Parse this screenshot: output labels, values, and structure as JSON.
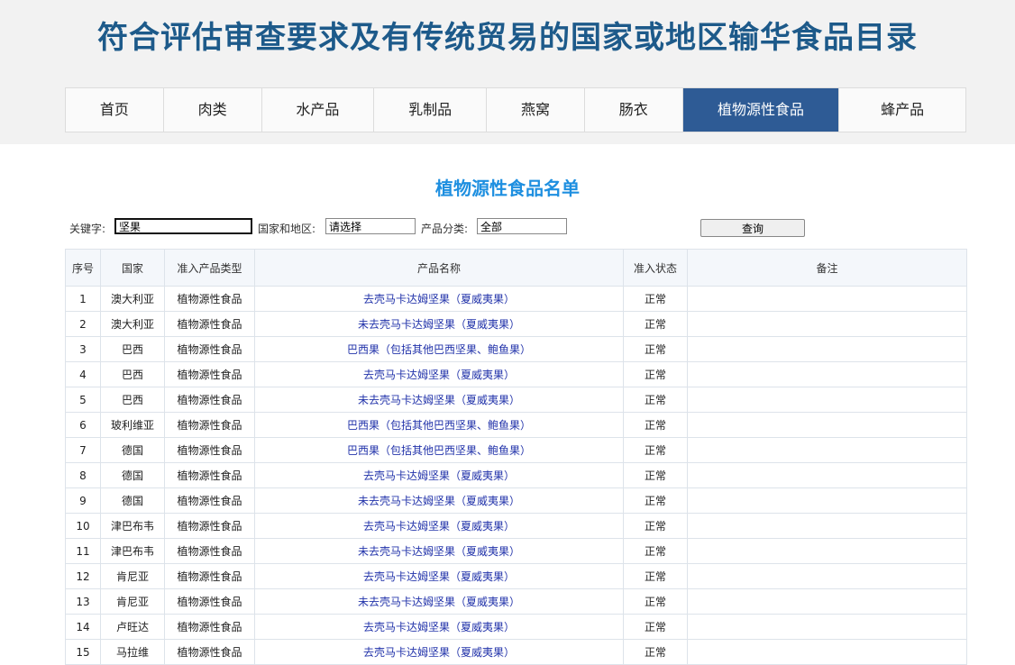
{
  "site_title": "符合评估审查要求及有传统贸易的国家或地区输华食品目录",
  "nav": [
    {
      "label": "首页"
    },
    {
      "label": "肉类"
    },
    {
      "label": "水产品"
    },
    {
      "label": "乳制品"
    },
    {
      "label": "燕窝"
    },
    {
      "label": "肠衣"
    },
    {
      "label": "植物源性食品",
      "active": true
    },
    {
      "label": "蜂产品"
    }
  ],
  "list_title": "植物源性食品名单",
  "search": {
    "keyword_label": "关键字:",
    "keyword_value": "坚果",
    "country_label": "国家和地区:",
    "country_value": "请选择",
    "category_label": "产品分类:",
    "category_value": "全部",
    "query_button": "查询"
  },
  "table": {
    "headers": {
      "seq": "序号",
      "country": "国家",
      "type": "准入产品类型",
      "product": "产品名称",
      "status": "准入状态",
      "remark": "备注"
    },
    "rows": [
      {
        "seq": "1",
        "country": "澳大利亚",
        "type": "植物源性食品",
        "product": "去壳马卡达姆坚果（夏威夷果）",
        "status": "正常",
        "remark": ""
      },
      {
        "seq": "2",
        "country": "澳大利亚",
        "type": "植物源性食品",
        "product": "未去壳马卡达姆坚果（夏威夷果）",
        "status": "正常",
        "remark": ""
      },
      {
        "seq": "3",
        "country": "巴西",
        "type": "植物源性食品",
        "product": "巴西果（包括其他巴西坚果、鲍鱼果）",
        "status": "正常",
        "remark": ""
      },
      {
        "seq": "4",
        "country": "巴西",
        "type": "植物源性食品",
        "product": "去壳马卡达姆坚果（夏威夷果）",
        "status": "正常",
        "remark": ""
      },
      {
        "seq": "5",
        "country": "巴西",
        "type": "植物源性食品",
        "product": "未去壳马卡达姆坚果（夏威夷果）",
        "status": "正常",
        "remark": ""
      },
      {
        "seq": "6",
        "country": "玻利维亚",
        "type": "植物源性食品",
        "product": "巴西果（包括其他巴西坚果、鲍鱼果）",
        "status": "正常",
        "remark": ""
      },
      {
        "seq": "7",
        "country": "德国",
        "type": "植物源性食品",
        "product": "巴西果（包括其他巴西坚果、鲍鱼果）",
        "status": "正常",
        "remark": ""
      },
      {
        "seq": "8",
        "country": "德国",
        "type": "植物源性食品",
        "product": "去壳马卡达姆坚果（夏威夷果）",
        "status": "正常",
        "remark": ""
      },
      {
        "seq": "9",
        "country": "德国",
        "type": "植物源性食品",
        "product": "未去壳马卡达姆坚果（夏威夷果）",
        "status": "正常",
        "remark": ""
      },
      {
        "seq": "10",
        "country": "津巴布韦",
        "type": "植物源性食品",
        "product": "去壳马卡达姆坚果（夏威夷果）",
        "status": "正常",
        "remark": ""
      },
      {
        "seq": "11",
        "country": "津巴布韦",
        "type": "植物源性食品",
        "product": "未去壳马卡达姆坚果（夏威夷果）",
        "status": "正常",
        "remark": ""
      },
      {
        "seq": "12",
        "country": "肯尼亚",
        "type": "植物源性食品",
        "product": "去壳马卡达姆坚果（夏威夷果）",
        "status": "正常",
        "remark": ""
      },
      {
        "seq": "13",
        "country": "肯尼亚",
        "type": "植物源性食品",
        "product": "未去壳马卡达姆坚果（夏威夷果）",
        "status": "正常",
        "remark": ""
      },
      {
        "seq": "14",
        "country": "卢旺达",
        "type": "植物源性食品",
        "product": "去壳马卡达姆坚果（夏威夷果）",
        "status": "正常",
        "remark": ""
      },
      {
        "seq": "15",
        "country": "马拉维",
        "type": "植物源性食品",
        "product": "去壳马卡达姆坚果（夏威夷果）",
        "status": "正常",
        "remark": ""
      }
    ]
  }
}
